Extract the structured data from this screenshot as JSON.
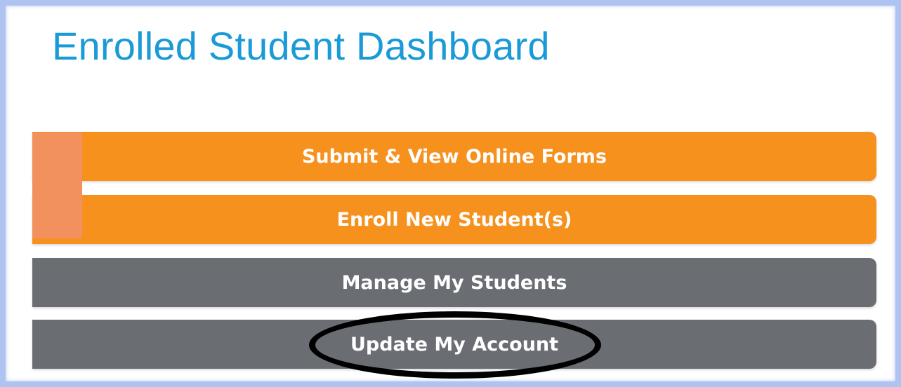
{
  "header": {
    "title": "Enrolled Student Dashboard"
  },
  "menu": {
    "items": [
      {
        "label": "Submit & View Online Forms",
        "color": "#f6911e"
      },
      {
        "label": "Enroll New Student(s)",
        "color": "#f6911e"
      },
      {
        "label": "Manage My Students",
        "color": "#6a6e73"
      },
      {
        "label": "Update My Account",
        "color": "#6a6e73"
      }
    ]
  },
  "annotation": {
    "highlighted_item": "Update My Account",
    "color": "#000000"
  },
  "colors": {
    "title": "#1a9ad6",
    "frame_border": "#aec3f2",
    "side_accent": "#f2915e"
  }
}
